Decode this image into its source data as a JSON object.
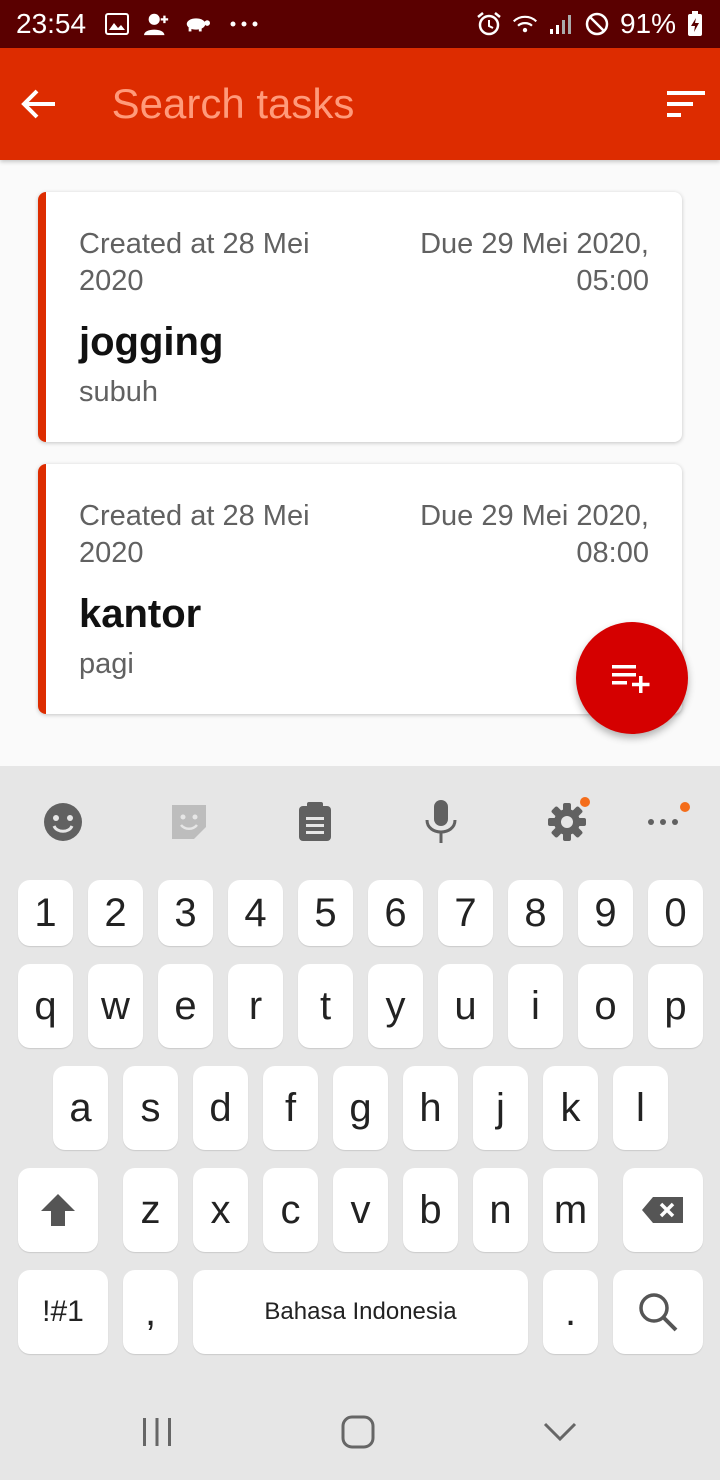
{
  "status_bar": {
    "time": "23:54",
    "battery": "91%",
    "icons": [
      "image-icon",
      "add-person-icon",
      "turtle-icon",
      "more-dots-icon",
      "alarm-icon",
      "wifi-icon",
      "signal-icon",
      "do-not-disturb-icon",
      "battery-charging-icon"
    ]
  },
  "toolbar": {
    "search_placeholder": "Search tasks",
    "search_value": "",
    "back_icon": "arrow-back-icon",
    "sort_icon": "sort-icon",
    "background": "#dd2c00"
  },
  "tasks": [
    {
      "created": "Created at 28 Mei 2020",
      "due": "Due 29 Mei 2020, 05:00",
      "title": "jogging",
      "description": "subuh",
      "accent": "#dd2c00"
    },
    {
      "created": "Created at 28 Mei 2020",
      "due": "Due 29 Mei 2020, 08:00",
      "title": "kantor",
      "description": "pagi",
      "accent": "#dd2c00"
    }
  ],
  "fab": {
    "icon": "playlist-add-icon",
    "color": "#d50000"
  },
  "keyboard": {
    "toolbar": [
      "emoji-icon",
      "sticker-icon",
      "clipboard-icon",
      "mic-icon",
      "settings-icon",
      "more-icon"
    ],
    "row_numbers": [
      "1",
      "2",
      "3",
      "4",
      "5",
      "6",
      "7",
      "8",
      "9",
      "0"
    ],
    "row_1": [
      "q",
      "w",
      "e",
      "r",
      "t",
      "y",
      "u",
      "i",
      "o",
      "p"
    ],
    "row_2": [
      "a",
      "s",
      "d",
      "f",
      "g",
      "h",
      "j",
      "k",
      "l"
    ],
    "row_3": [
      "z",
      "x",
      "c",
      "v",
      "b",
      "n",
      "m"
    ],
    "symbols_label": "!#1",
    "comma_label": ",",
    "space_label": "Bahasa Indonesia",
    "period_label": "."
  },
  "navbar": [
    "recents-icon",
    "home-icon",
    "back-chevron-icon"
  ]
}
